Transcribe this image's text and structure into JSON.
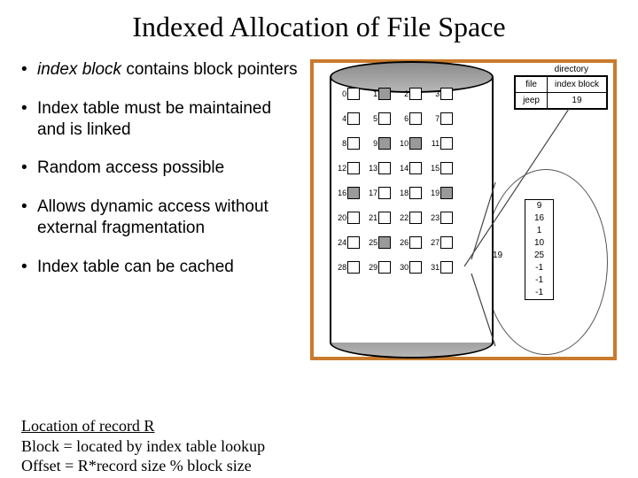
{
  "title": "Indexed Allocation of File Space",
  "bullets": [
    {
      "prefix_italic": "index block",
      "rest": " contains block pointers"
    },
    {
      "prefix_italic": "",
      "rest": "Index table must be maintained and is linked"
    },
    {
      "prefix_italic": "",
      "rest": "Random access possible"
    },
    {
      "prefix_italic": "",
      "rest": "Allows dynamic access without external fragmentation"
    },
    {
      "prefix_italic": "",
      "rest": "Index table can be cached"
    }
  ],
  "directory": {
    "label": "directory",
    "headers": [
      "file",
      "index block"
    ],
    "row": [
      "jeep",
      "19"
    ]
  },
  "disk_blocks": {
    "total": 32,
    "filled": [
      1,
      9,
      10,
      16,
      19,
      25
    ]
  },
  "index_block": {
    "number": "19",
    "entries": [
      "9",
      "16",
      "1",
      "10",
      "25",
      "-1",
      "-1",
      "-1"
    ]
  },
  "location": {
    "heading": "Location of record R",
    "line1": "Block = located by index table lookup",
    "line2": "Offset = R*record size % block size"
  }
}
